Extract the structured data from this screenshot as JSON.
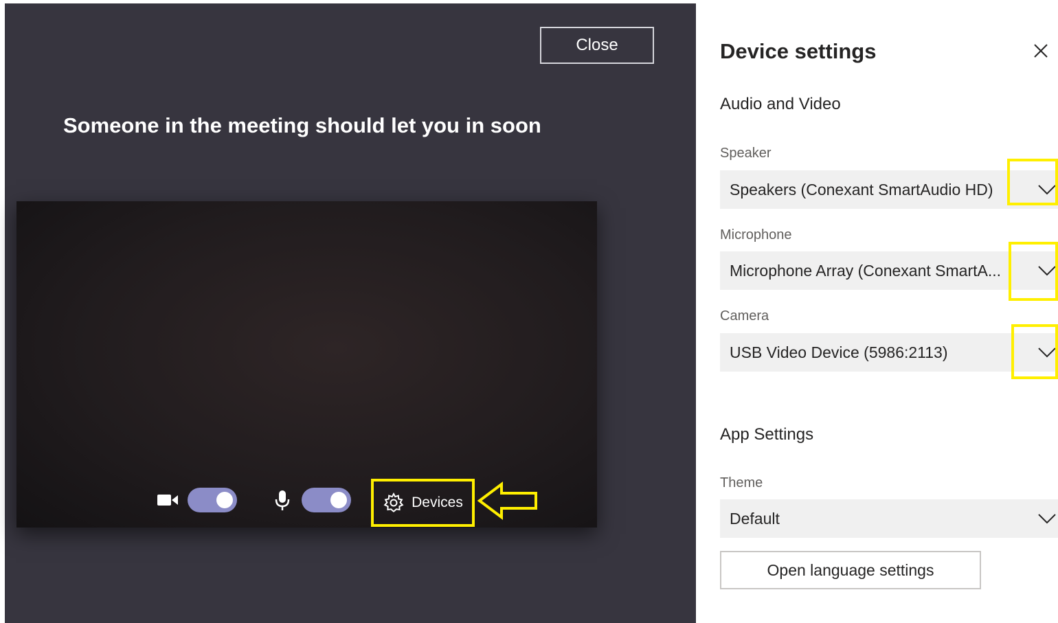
{
  "lobby": {
    "close_label": "Close",
    "waiting_message": "Someone in the meeting should let you in soon",
    "camera_toggle_on": true,
    "mic_toggle_on": true,
    "devices_label": "Devices",
    "toggle_color": "#8b8cc7",
    "annotation_color": "#ffef00"
  },
  "panel": {
    "title": "Device settings",
    "audio_video_heading": "Audio and Video",
    "speaker": {
      "label": "Speaker",
      "value": "Speakers (Conexant SmartAudio HD)"
    },
    "microphone": {
      "label": "Microphone",
      "value": "Microphone Array (Conexant SmartA..."
    },
    "camera": {
      "label": "Camera",
      "value": "USB Video Device (5986:2113)"
    },
    "app_settings_heading": "App Settings",
    "theme": {
      "label": "Theme",
      "value": "Default"
    },
    "language_button": "Open language settings"
  }
}
